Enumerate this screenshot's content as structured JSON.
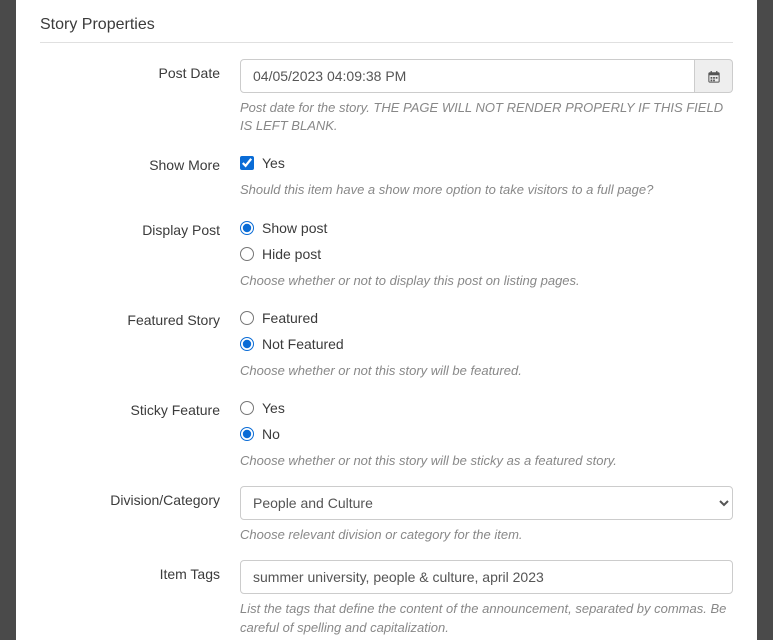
{
  "section_title": "Story Properties",
  "post_date": {
    "label": "Post Date",
    "value": "04/05/2023 04:09:38 PM",
    "help": "Post date for the story. THE PAGE WILL NOT RENDER PROPERLY IF THIS FIELD IS LEFT BLANK."
  },
  "show_more": {
    "label": "Show More",
    "option": "Yes",
    "help": "Should this item have a show more option to take visitors to a full page?"
  },
  "display_post": {
    "label": "Display Post",
    "option1": "Show post",
    "option2": "Hide post",
    "help": "Choose whether or not to display this post on listing pages."
  },
  "featured": {
    "label": "Featured Story",
    "option1": "Featured",
    "option2": "Not Featured",
    "help": "Choose whether or not this story will be featured."
  },
  "sticky": {
    "label": "Sticky Feature",
    "option1": "Yes",
    "option2": "No",
    "help": "Choose whether or not this story will be sticky as a featured story."
  },
  "division": {
    "label": "Division/Category",
    "selected": "People and Culture",
    "help": "Choose relevant division or category for the item."
  },
  "tags": {
    "label": "Item Tags",
    "value": "summer university, people & culture, april 2023",
    "help": "List the tags that define the content of the announcement, separated by commas. Be careful of spelling and capitalization."
  }
}
